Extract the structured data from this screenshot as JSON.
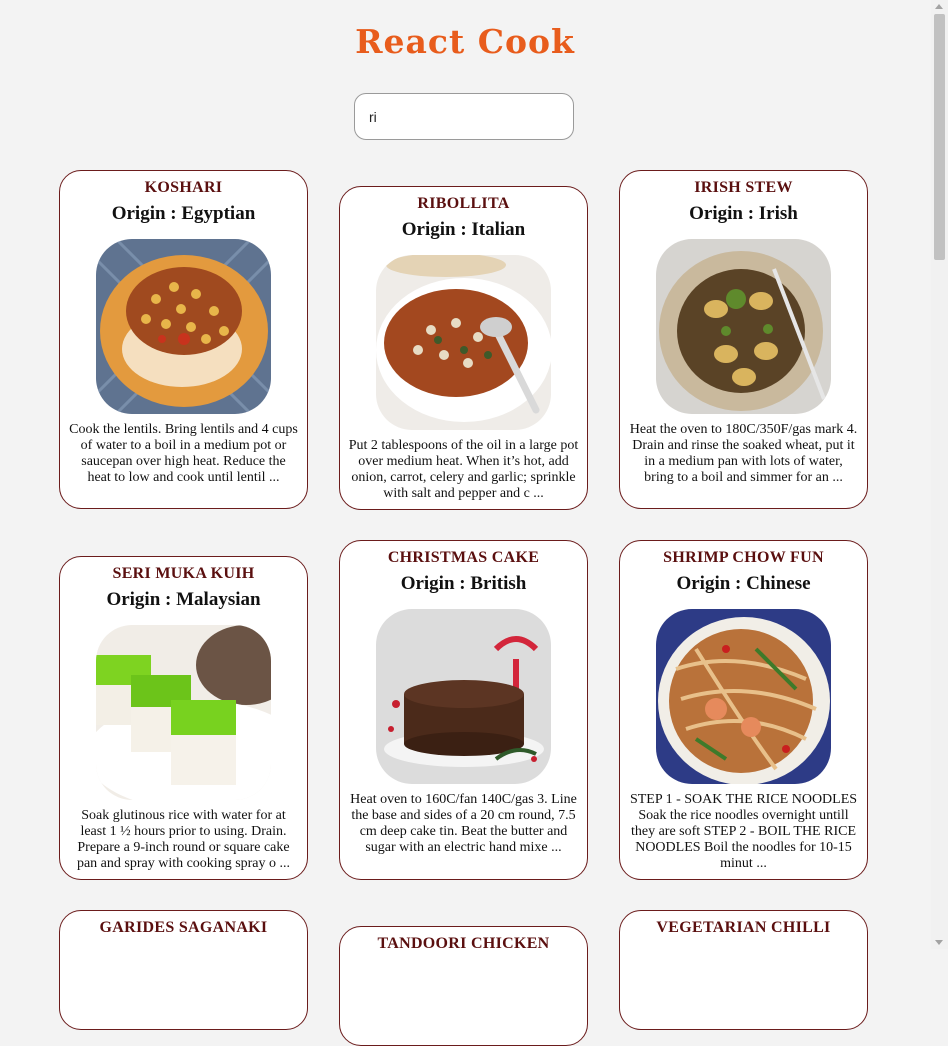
{
  "app": {
    "title": "React Cook"
  },
  "search": {
    "value": "ri",
    "placeholder": ""
  },
  "recipes": [
    {
      "name": "KOSHARI",
      "origin": "Origin : Egyptian",
      "description": "Cook the lentils. Bring lentils and 4 cups of water to a boil in a medium pot or saucepan over high heat. Reduce the heat to low and cook until lentil ...",
      "image": "koshari-photo"
    },
    {
      "name": "RIBOLLITA",
      "origin": "Origin : Italian",
      "description": "Put 2 tablespoons of the oil in a large pot over medium heat. When it’s hot, add onion, carrot, celery and garlic; sprinkle with salt and pepper and c ...",
      "image": "ribollita-photo"
    },
    {
      "name": "IRISH STEW",
      "origin": "Origin : Irish",
      "description": "Heat the oven to 180C/350F/gas mark 4. Drain and rinse the soaked wheat, put it in a medium pan with lots of water, bring to a boil and simmer for an ...",
      "image": "irish-stew-photo"
    },
    {
      "name": "SERI MUKA KUIH",
      "origin": "Origin : Malaysian",
      "description": "Soak glutinous rice with water for at least 1 ½ hours prior to using. Drain. Prepare a 9-inch round or square cake pan and spray with cooking spray o ...",
      "image": "seri-muka-kuih-photo"
    },
    {
      "name": "CHRISTMAS CAKE",
      "origin": "Origin : British",
      "description": "Heat oven to 160C/fan 140C/gas 3. Line the base and sides of a 20 cm round, 7.5 cm deep cake tin. Beat the butter and sugar with an electric hand mixe ...",
      "image": "christmas-cake-photo"
    },
    {
      "name": "SHRIMP CHOW FUN",
      "origin": "Origin : Chinese",
      "description": "STEP 1 - SOAK THE RICE NOODLES Soak the rice noodles overnight untill they are soft STEP 2 - BOIL THE RICE NOODLES Boil the noodles for 10-15 minut ...",
      "image": "shrimp-chow-fun-photo"
    },
    {
      "name": "GARIDES SAGANAKI",
      "origin": "",
      "description": "",
      "image": ""
    },
    {
      "name": "TANDOORI CHICKEN",
      "origin": "",
      "description": "",
      "image": ""
    },
    {
      "name": "VEGETARIAN CHILLI",
      "origin": "",
      "description": "",
      "image": ""
    }
  ],
  "colors": {
    "title": "#e85c1c",
    "card_border": "#6b1c1c",
    "card_name": "#5a0f0f",
    "background": "#f3f3f3"
  }
}
